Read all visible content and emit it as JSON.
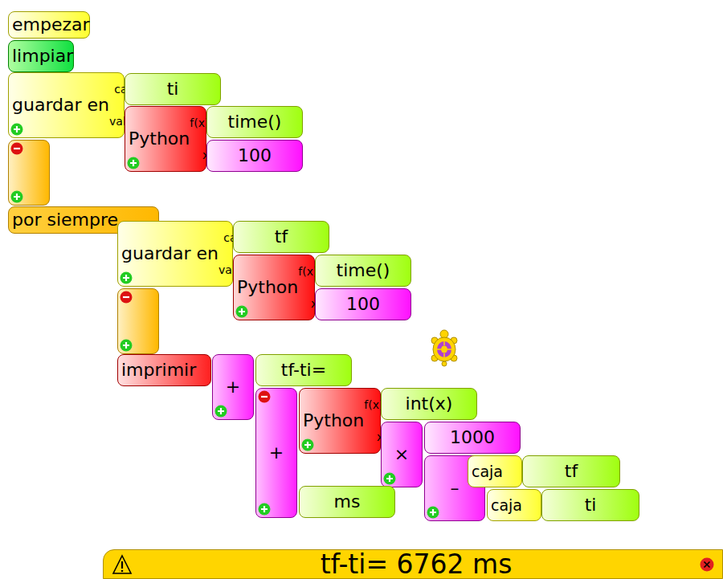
{
  "blocks": [
    {
      "kind": "start",
      "label": "empezar"
    },
    {
      "kind": "action",
      "label": "limpiar"
    },
    {
      "kind": "store",
      "label": "guardar en",
      "ports": [
        "caja",
        "valor"
      ]
    },
    {
      "kind": "text",
      "label": "ti"
    },
    {
      "kind": "python",
      "label": "Python",
      "ports": [
        "f(x)",
        "x"
      ]
    },
    {
      "kind": "text",
      "label": "time()"
    },
    {
      "kind": "number",
      "label": "100"
    },
    {
      "kind": "clamp",
      "expanded": true
    },
    {
      "kind": "loop",
      "label": "por siempre"
    },
    {
      "kind": "store",
      "label": "guardar en",
      "ports": [
        "caja",
        "valor"
      ]
    },
    {
      "kind": "text",
      "label": "tf"
    },
    {
      "kind": "python",
      "label": "Python",
      "ports": [
        "f(x)",
        "x"
      ]
    },
    {
      "kind": "text",
      "label": "time()"
    },
    {
      "kind": "number",
      "label": "100"
    },
    {
      "kind": "clamp",
      "expanded": true
    },
    {
      "kind": "print",
      "label": "imprimir"
    },
    {
      "kind": "operator",
      "label": "+"
    },
    {
      "kind": "text",
      "label": "tf-ti="
    },
    {
      "kind": "operator",
      "label": "+",
      "expanded": true
    },
    {
      "kind": "python",
      "label": "Python",
      "ports": [
        "f(x)",
        "x"
      ]
    },
    {
      "kind": "text",
      "label": "int(x)"
    },
    {
      "kind": "operator",
      "label": "×"
    },
    {
      "kind": "number",
      "label": "1000"
    },
    {
      "kind": "operator",
      "label": "–"
    },
    {
      "kind": "box",
      "label": "caja"
    },
    {
      "kind": "text",
      "label": "tf"
    },
    {
      "kind": "box",
      "label": "caja"
    },
    {
      "kind": "text",
      "label": "ti"
    },
    {
      "kind": "text",
      "label": "ms"
    }
  ],
  "status_bar": {
    "message": "tf-ti= 6762 ms"
  }
}
